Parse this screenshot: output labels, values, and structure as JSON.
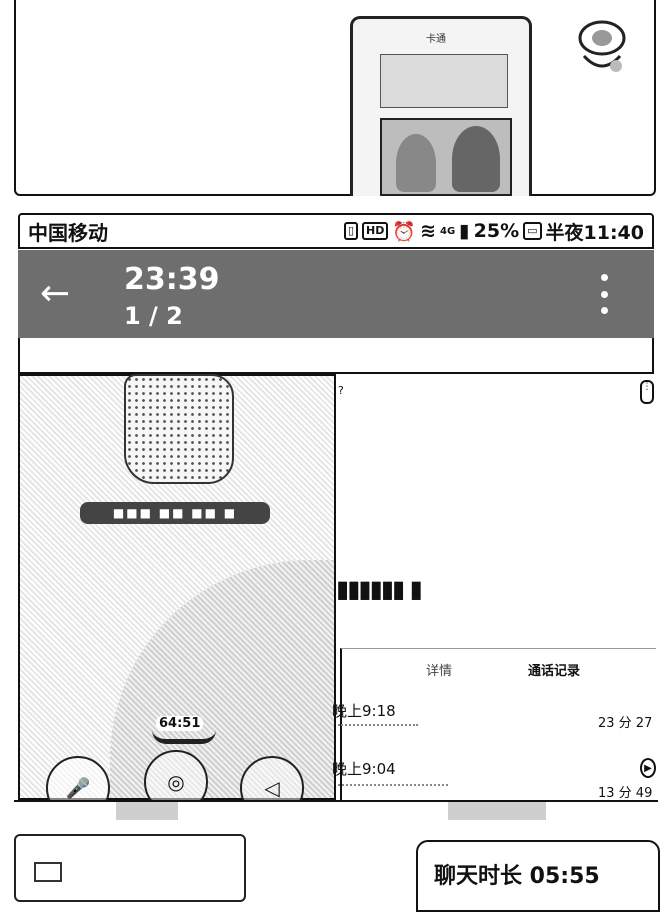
{
  "top": {
    "phone_logo_text": "卡通"
  },
  "status_bar": {
    "carrier": "中国移动",
    "signal_type": "4G",
    "battery": "25%",
    "clock": "半夜11:40"
  },
  "header": {
    "title_time": "23:39",
    "page_indicator": "1 / 2"
  },
  "call_screen": {
    "contact_name": "■■■ ■■ ■■ ■",
    "timer": "64:51"
  },
  "detail_panel": {
    "tabs": [
      "详情",
      "通话记录"
    ],
    "records": [
      {
        "time": "晚上9:18",
        "duration": "23 分 27"
      },
      {
        "time": "晚上9:04",
        "duration": "13 分 49"
      }
    ]
  },
  "chat": {
    "duration_text": "聊天时长 05:55"
  },
  "colors": {
    "header_bg": "#6e6e6e",
    "text": "#111111"
  }
}
